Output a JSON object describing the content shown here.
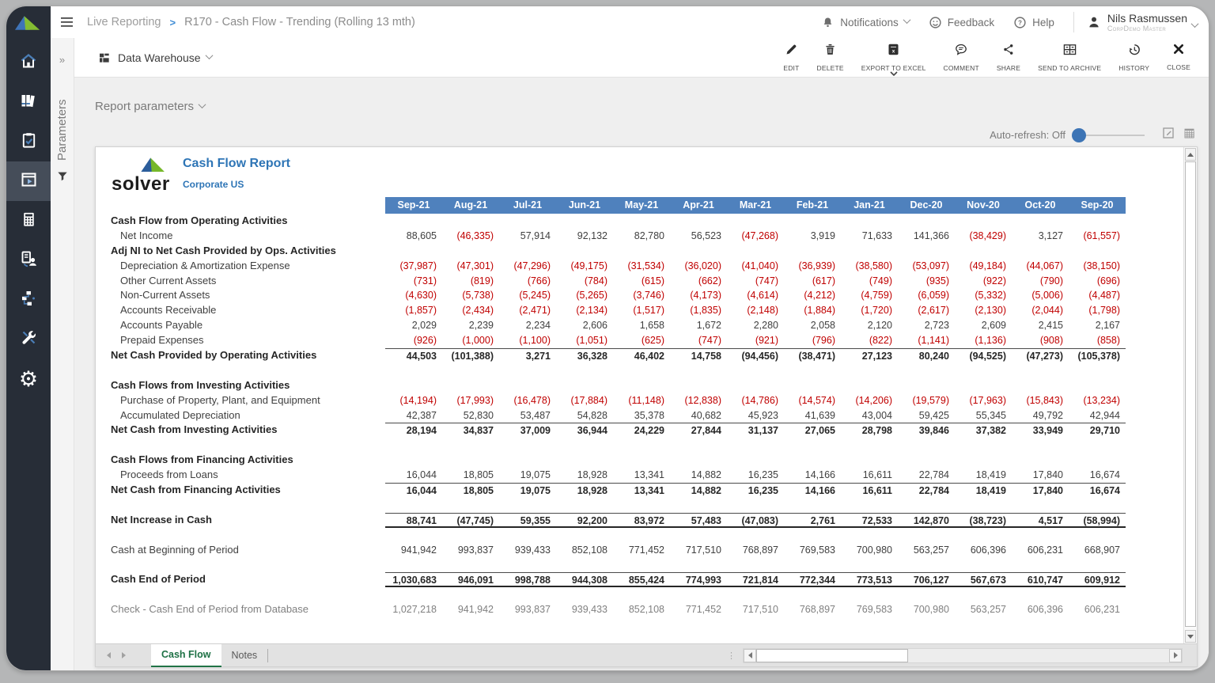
{
  "topbar": {
    "breadcrumb": {
      "root": "Live Reporting",
      "separator": ">",
      "current": "R170 - Cash Flow - Trending (Rolling 13 mth)"
    },
    "notifications_label": "Notifications",
    "feedback_label": "Feedback",
    "help_label": "Help",
    "user": {
      "name": "Nils Rasmussen",
      "role": "CorpDemo Master"
    }
  },
  "sidebar": {
    "items": [
      {
        "icon": "home"
      },
      {
        "icon": "library"
      },
      {
        "icon": "tasks"
      },
      {
        "icon": "reports",
        "active": true
      },
      {
        "icon": "calculator"
      },
      {
        "icon": "collaboration"
      },
      {
        "icon": "integrations"
      },
      {
        "icon": "tools"
      },
      {
        "icon": "settings"
      }
    ]
  },
  "params_panel": {
    "label": "Parameters"
  },
  "toolbar": {
    "source_label": "Data Warehouse",
    "actions": [
      {
        "icon": "edit",
        "label": "EDIT"
      },
      {
        "icon": "delete",
        "label": "DELETE"
      },
      {
        "icon": "excel",
        "label": "EXPORT TO EXCEL",
        "has_dropdown": true
      },
      {
        "icon": "comment",
        "label": "COMMENT"
      },
      {
        "icon": "share",
        "label": "SHARE"
      },
      {
        "icon": "archive",
        "label": "SEND TO ARCHIVE"
      },
      {
        "icon": "history",
        "label": "HISTORY"
      },
      {
        "icon": "close",
        "label": "CLOSE"
      }
    ]
  },
  "report_parameters_label": "Report parameters",
  "auto_refresh_label": "Auto-refresh: Off",
  "report": {
    "logo_text": "solver",
    "title": "Cash Flow Report",
    "subtitle": "Corporate US",
    "columns": [
      "Sep-21",
      "Aug-21",
      "Jul-21",
      "Jun-21",
      "May-21",
      "Apr-21",
      "Mar-21",
      "Feb-21",
      "Jan-21",
      "Dec-20",
      "Nov-20",
      "Oct-20",
      "Sep-20"
    ],
    "rows": [
      {
        "type": "section",
        "label": "Cash Flow from Operating Activities"
      },
      {
        "type": "item",
        "label": "Net Income",
        "values": [
          88605,
          -46335,
          57914,
          92132,
          82780,
          56523,
          -47268,
          3919,
          71633,
          141366,
          -38429,
          3127,
          -61557
        ]
      },
      {
        "type": "section",
        "label": "Adj NI to Net Cash Provided by Ops. Activities"
      },
      {
        "type": "item",
        "label": "Depreciation & Amortization Expense",
        "values": [
          -37987,
          -47301,
          -47296,
          -49175,
          -31534,
          -36020,
          -41040,
          -36939,
          -38580,
          -53097,
          -49184,
          -44067,
          -38150
        ]
      },
      {
        "type": "item",
        "label": "Other Current Assets",
        "values": [
          -731,
          -819,
          -766,
          -784,
          -615,
          -662,
          -747,
          -617,
          -749,
          -935,
          -922,
          -790,
          -696
        ]
      },
      {
        "type": "item",
        "label": "Non-Current Assets",
        "values": [
          -4630,
          -5738,
          -5245,
          -5265,
          -3746,
          -4173,
          -4614,
          -4212,
          -4759,
          -6059,
          -5332,
          -5006,
          -4487
        ]
      },
      {
        "type": "item",
        "label": "Accounts Receivable",
        "values": [
          -1857,
          -2434,
          -2471,
          -2134,
          -1517,
          -1835,
          -2148,
          -1884,
          -1720,
          -2617,
          -2130,
          -2044,
          -1798
        ]
      },
      {
        "type": "item",
        "label": "Accounts Payable",
        "values": [
          2029,
          2239,
          2234,
          2606,
          1658,
          1672,
          2280,
          2058,
          2120,
          2723,
          2609,
          2415,
          2167
        ]
      },
      {
        "type": "item",
        "label": "Prepaid Expenses",
        "values": [
          -926,
          -1000,
          -1100,
          -1051,
          -625,
          -747,
          -921,
          -796,
          -822,
          -1141,
          -1136,
          -908,
          -858
        ]
      },
      {
        "type": "total",
        "label": "Net Cash Provided by Operating Activities",
        "border_top": true,
        "values": [
          44503,
          -101388,
          3271,
          36328,
          46402,
          14758,
          -94456,
          -38471,
          27123,
          80240,
          -94525,
          -47273,
          -105378
        ]
      },
      {
        "type": "spacer"
      },
      {
        "type": "section",
        "label": "Cash Flows from Investing Activities"
      },
      {
        "type": "item",
        "label": "Purchase of Property, Plant, and Equipment",
        "values": [
          -14194,
          -17993,
          -16478,
          -17884,
          -11148,
          -12838,
          -14786,
          -14574,
          -14206,
          -19579,
          -17963,
          -15843,
          -13234
        ]
      },
      {
        "type": "item",
        "label": "Accumulated Depreciation",
        "values": [
          42387,
          52830,
          53487,
          54828,
          35378,
          40682,
          45923,
          41639,
          43004,
          59425,
          55345,
          49792,
          42944
        ]
      },
      {
        "type": "total",
        "label": "Net Cash from Investing Activities",
        "border_top": true,
        "values": [
          28194,
          34837,
          37009,
          36944,
          24229,
          27844,
          31137,
          27065,
          28798,
          39846,
          37382,
          33949,
          29710
        ]
      },
      {
        "type": "spacer"
      },
      {
        "type": "section",
        "label": "Cash Flows from Financing Activities"
      },
      {
        "type": "item",
        "label": "Proceeds from Loans",
        "values": [
          16044,
          18805,
          19075,
          18928,
          13341,
          14882,
          16235,
          14166,
          16611,
          22784,
          18419,
          17840,
          16674
        ]
      },
      {
        "type": "total",
        "label": "Net Cash from Financing Activities",
        "border_top": true,
        "values": [
          16044,
          18805,
          19075,
          18928,
          13341,
          14882,
          16235,
          14166,
          16611,
          22784,
          18419,
          17840,
          16674
        ]
      },
      {
        "type": "spacer"
      },
      {
        "type": "total",
        "label": "Net Increase in Cash",
        "border_top": true,
        "border_bottom": "thick",
        "values": [
          88741,
          -47745,
          59355,
          92200,
          83972,
          57483,
          -47083,
          2761,
          72533,
          142870,
          -38723,
          4517,
          -58994
        ]
      },
      {
        "type": "spacer"
      },
      {
        "type": "plain",
        "label": "Cash at Beginning of Period",
        "values": [
          941942,
          993837,
          939433,
          852108,
          771452,
          717510,
          768897,
          769583,
          700980,
          563257,
          606396,
          606231,
          668907
        ]
      },
      {
        "type": "spacer"
      },
      {
        "type": "total",
        "label": "Cash End of Period",
        "border_top": true,
        "border_bottom": "thick",
        "values": [
          1030683,
          946091,
          998788,
          944308,
          855424,
          774993,
          721814,
          772344,
          773513,
          706127,
          567673,
          610747,
          609912
        ]
      },
      {
        "type": "spacer"
      },
      {
        "type": "check",
        "label": "Check - Cash End of Period from Database",
        "values": [
          1027218,
          941942,
          993837,
          939433,
          852108,
          771452,
          717510,
          768897,
          769583,
          700980,
          563257,
          606396,
          606231
        ]
      }
    ]
  },
  "tabs": {
    "active": "Cash Flow",
    "inactive": "Notes"
  },
  "colors": {
    "header_bg": "#4f81bd",
    "negative": "#c00000",
    "tab_green": "#217346",
    "accent_blue": "#2e75b6",
    "sidebar_bg": "#272d37"
  }
}
